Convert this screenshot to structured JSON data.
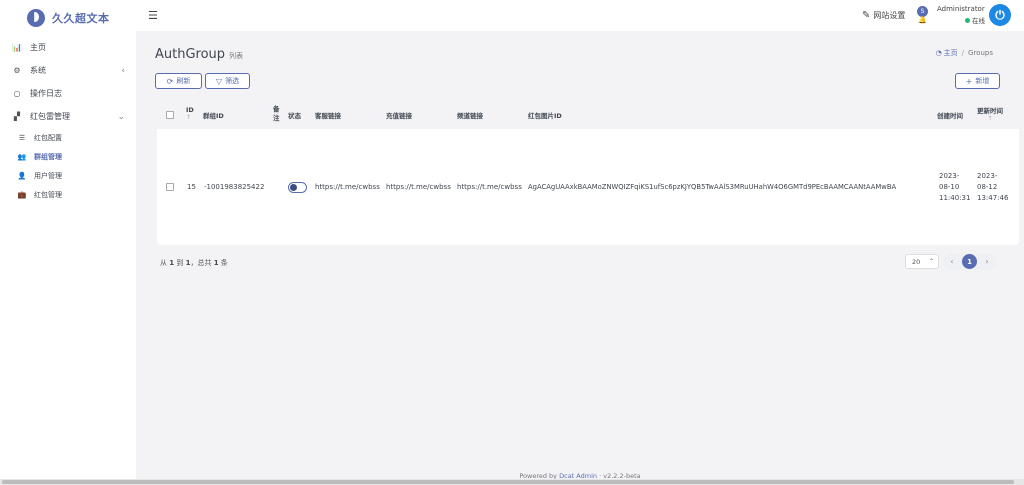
{
  "brand": {
    "name": "久久超文本"
  },
  "sidebar": {
    "items": [
      {
        "label": "主页",
        "icon": "bar-chart-icon"
      },
      {
        "label": "系统",
        "icon": "gear-icon",
        "chevron": "‹"
      },
      {
        "label": "操作日志",
        "icon": "circle-icon"
      },
      {
        "label": "红包雷管理",
        "icon": "grid-icon",
        "chevron": "⌄"
      }
    ],
    "subitems": [
      {
        "label": "红包配置",
        "icon": "sliders-icon"
      },
      {
        "label": "群组管理",
        "icon": "users-icon",
        "active": true
      },
      {
        "label": "用户管理",
        "icon": "user-icon"
      },
      {
        "label": "红包管理",
        "icon": "briefcase-icon"
      }
    ]
  },
  "topbar": {
    "site_settings": "网站设置",
    "user_initial": "S",
    "user_name": "Administrator",
    "user_status": "在线"
  },
  "page": {
    "title": "AuthGroup",
    "subtitle": "列表",
    "breadcrumb_home": "主页",
    "breadcrumb_current": "Groups"
  },
  "toolbar": {
    "refresh_label": "刷新",
    "filter_label": "筛选",
    "new_label": "新增"
  },
  "table": {
    "columns": {
      "id": "ID",
      "group_id": "群组ID",
      "remark_1": "备",
      "remark_2": "注",
      "status": "状态",
      "service_link": "客服链接",
      "recharge_link": "充值链接",
      "channel_link": "频道链接",
      "redpacket_image_id": "红包图片ID",
      "created_at": "创建时间",
      "updated_at": "更新时间"
    },
    "rows": [
      {
        "id": "15",
        "group_id": "-1001983825422",
        "status_on": false,
        "service_link": "https://t.me/cwbss",
        "recharge_link": "https://t.me/cwbss",
        "channel_link": "https://t.me/cwbss",
        "redpacket_image_id": "AgACAgUAAxkBAAMoZNWQIZFqiKS1ufSc6pzKJYQB5TwAAlS3MRuUHahW4O6GMTd9PEcBAAMCAANtAAMwBA",
        "created_at_1": "2023-",
        "created_at_2": "08-10",
        "created_at_3": "11:40:31",
        "updated_at_1": "2023-",
        "updated_at_2": "08-12",
        "updated_at_3": "13:47:46"
      }
    ]
  },
  "pager": {
    "summary_prefix": "从",
    "from": "1",
    "to_word": "到",
    "to": "1",
    "total_prefix": "，总共",
    "total": "1",
    "total_suffix": "条",
    "per_page": "20",
    "current_page": "1"
  },
  "footer": {
    "powered_by": "Powered by",
    "product": "Dcat Admin",
    "version": "· v2.2.2-beta"
  }
}
